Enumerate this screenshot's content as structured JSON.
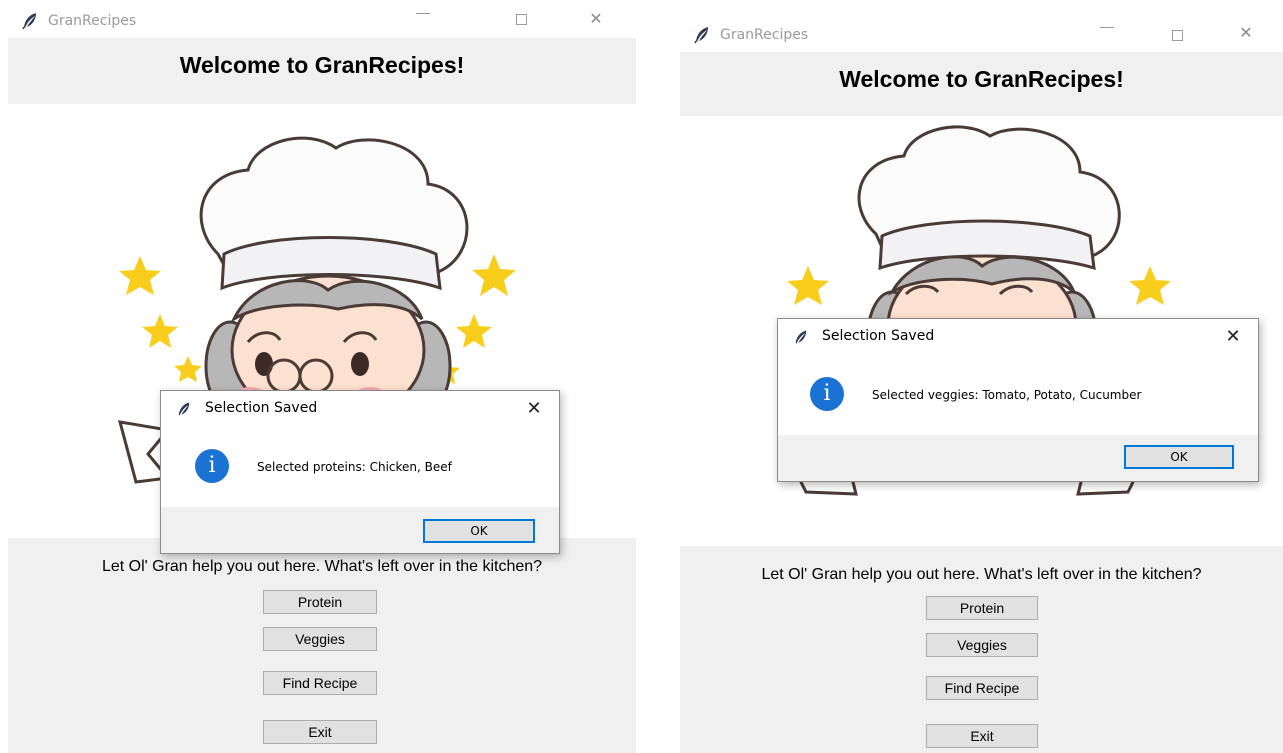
{
  "app": {
    "title": "GranRecipes",
    "window_controls": {
      "minimize": "—",
      "maximize": "☐",
      "close": "✕"
    }
  },
  "main": {
    "welcome": "Welcome to GranRecipes!",
    "prompt": "Let Ol' Gran help you out here. What's left over in the kitchen?",
    "buttons": {
      "protein": "Protein",
      "veggies": "Veggies",
      "find_recipe": "Find Recipe",
      "exit": "Exit"
    }
  },
  "dialogs": {
    "left": {
      "title": "Selection Saved",
      "message": "Selected proteins: Chicken, Beef",
      "ok": "OK",
      "close": "✕",
      "icon_glyph": "i"
    },
    "right": {
      "title": "Selection Saved",
      "message": "Selected veggies: Tomato, Potato, Cucumber",
      "ok": "OK",
      "close": "✕",
      "icon_glyph": "i"
    }
  },
  "icons": {
    "app_icon": "feather-icon",
    "info_icon": "info-icon",
    "close_icon": "close-icon"
  },
  "colors": {
    "window_bg": "#f0f0f0",
    "canvas_bg": "#ffffff",
    "info_blue": "#1a73d4",
    "focus_blue": "#0078d7",
    "star_yellow": "#f9cd1b",
    "button_bg": "#e1e1e1"
  }
}
